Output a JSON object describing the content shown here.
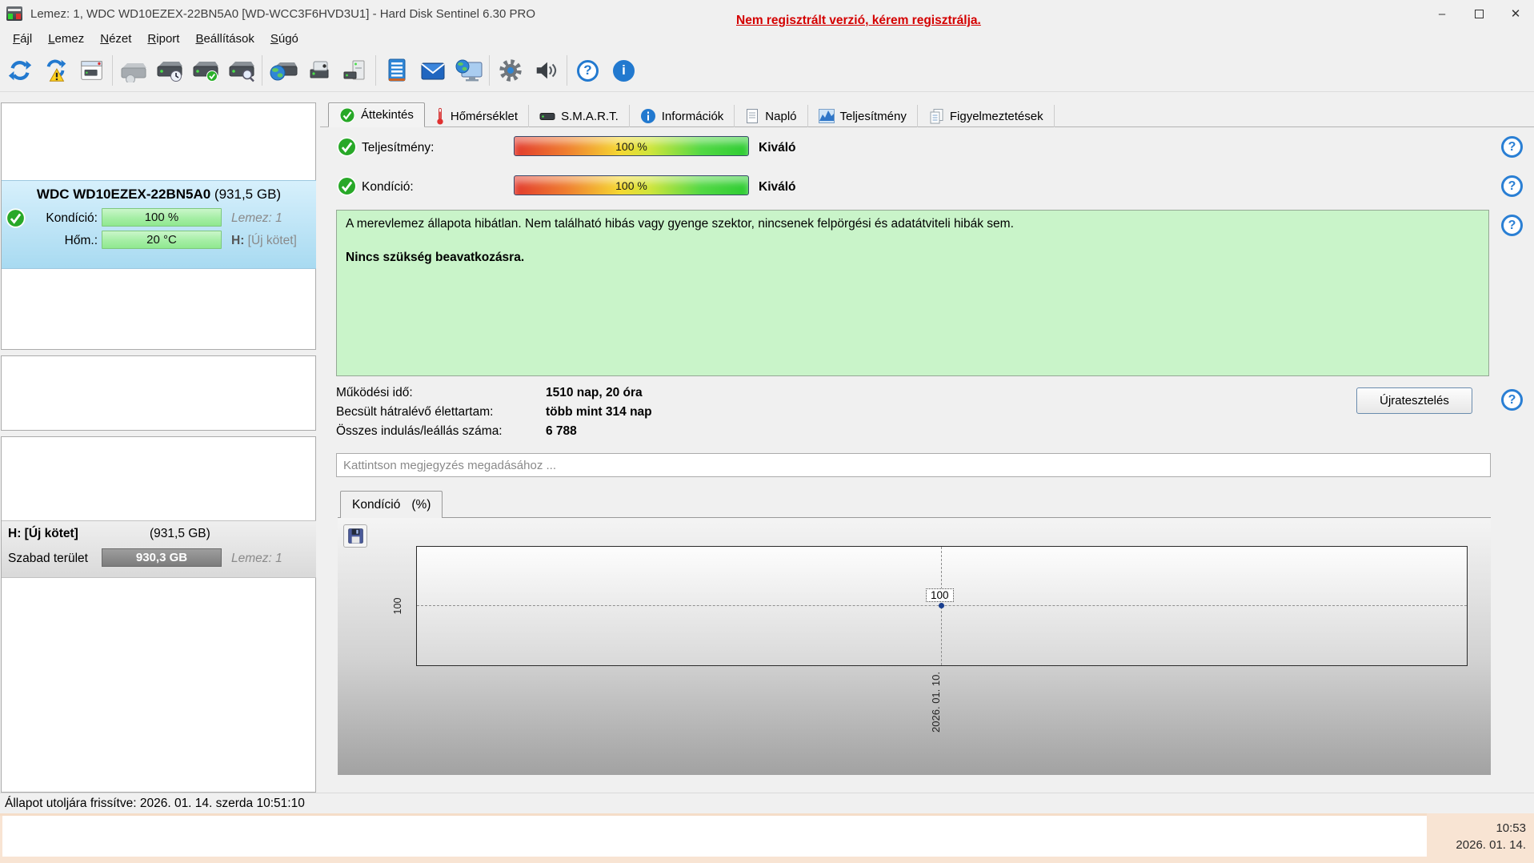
{
  "window": {
    "title": "Lemez: 1, WDC WD10EZEX-22BN5A0 [WD-WCC3F6HVD3U1]  -  Hard Disk Sentinel 6.30 PRO",
    "controls": {
      "minimize": "–",
      "close": "✕"
    }
  },
  "menu": [
    "Fájl",
    "Lemez",
    "Nézet",
    "Riport",
    "Beállítások",
    "Súgó"
  ],
  "toolbar": {
    "notice": "Nem regisztrált verzió, kérem regisztrálja.",
    "help_glyph": "?",
    "info_glyph": "i",
    "icon_names": [
      "refresh-icon",
      "refresh-warning-icon",
      "report-window-icon",
      "disk-disabled-icon",
      "disk-schedule-icon",
      "disk-accept-icon",
      "disk-search-icon",
      "disk-network-icon",
      "device-camera-icon",
      "computer-disk-icon",
      "notes-icon",
      "mail-icon",
      "web-monitor-icon",
      "gear-icon",
      "speaker-icon",
      "help-icon",
      "info-icon"
    ]
  },
  "tabs": [
    {
      "label": "Áttekintés",
      "icon": "check-circle-icon"
    },
    {
      "label": "Hőmérséklet",
      "icon": "thermometer-icon"
    },
    {
      "label": "S.M.A.R.T.",
      "icon": "disk-icon"
    },
    {
      "label": "Információk",
      "icon": "info-circle-icon"
    },
    {
      "label": "Napló",
      "icon": "page-icon"
    },
    {
      "label": "Teljesítmény",
      "icon": "area-chart-icon"
    },
    {
      "label": "Figyelmeztetések",
      "icon": "pages-icon"
    }
  ],
  "overview": {
    "performance": {
      "label": "Teljesítmény:",
      "value": "100 %",
      "rating": "Kiváló"
    },
    "condition": {
      "label": "Kondíció:",
      "value": "100 %",
      "rating": "Kiváló"
    },
    "health_text": "A merevlemez állapota hibátlan. Nem található hibás vagy gyenge szektor, nincsenek felpörgési és adatátviteli hibák sem.",
    "health_action": "Nincs szükség beavatkozásra.",
    "stats": [
      {
        "label": "Működési idő:",
        "value": "1510 nap, 20 óra"
      },
      {
        "label": "Becsült hátralévő élettartam:",
        "value": "több mint 314 nap"
      },
      {
        "label": "Összes indulás/leállás száma:",
        "value": "6 788"
      }
    ],
    "retest_button": "Újratesztelés",
    "comment_placeholder": "Kattintson megjegyzés megadásához ..."
  },
  "sidebar": {
    "disk_panel": {
      "model": "WDC WD10EZEX-22BN5A0",
      "capacity": "(931,5 GB)",
      "condition_label": "Kondíció:",
      "condition_value": "100 %",
      "temperature_label": "Hőm.:",
      "temperature_value": "20 °C",
      "disk_number": "Lemez: 1",
      "volume_prefix": "H:",
      "volume_name": "[Új kötet]"
    },
    "volume_panel": {
      "title": "H: [Új kötet]",
      "capacity": "(931,5 GB)",
      "free_label": "Szabad terület",
      "free_value": "930,3 GB",
      "disk_number": "Lemez: 1"
    }
  },
  "chart": {
    "tab_name": "Kondíció",
    "tab_unit": "(%)"
  },
  "chart_data": {
    "type": "line",
    "title": "Kondíció (%)",
    "x": [
      "2026. 01. 10."
    ],
    "series": [
      {
        "name": "Kondíció",
        "values": [
          100
        ]
      }
    ],
    "point_label": "100",
    "y_ticks": [
      "100"
    ],
    "ylim": [
      0,
      110
    ],
    "grid": "dashed",
    "legend": "none"
  },
  "statusbar": {
    "text": "Állapot utoljára frissítve: 2026. 01. 14. szerda 10:51:10"
  },
  "taskbar": {
    "time": "10:53",
    "date": "2026. 01. 14."
  },
  "colors": {
    "accent_blue": "#2279cf",
    "notice_red": "#d40000",
    "health_green_bg": "#c9f4c9",
    "disk_panel_blue": "#a8daf1",
    "taskbar_peach": "#f8e4d3"
  }
}
